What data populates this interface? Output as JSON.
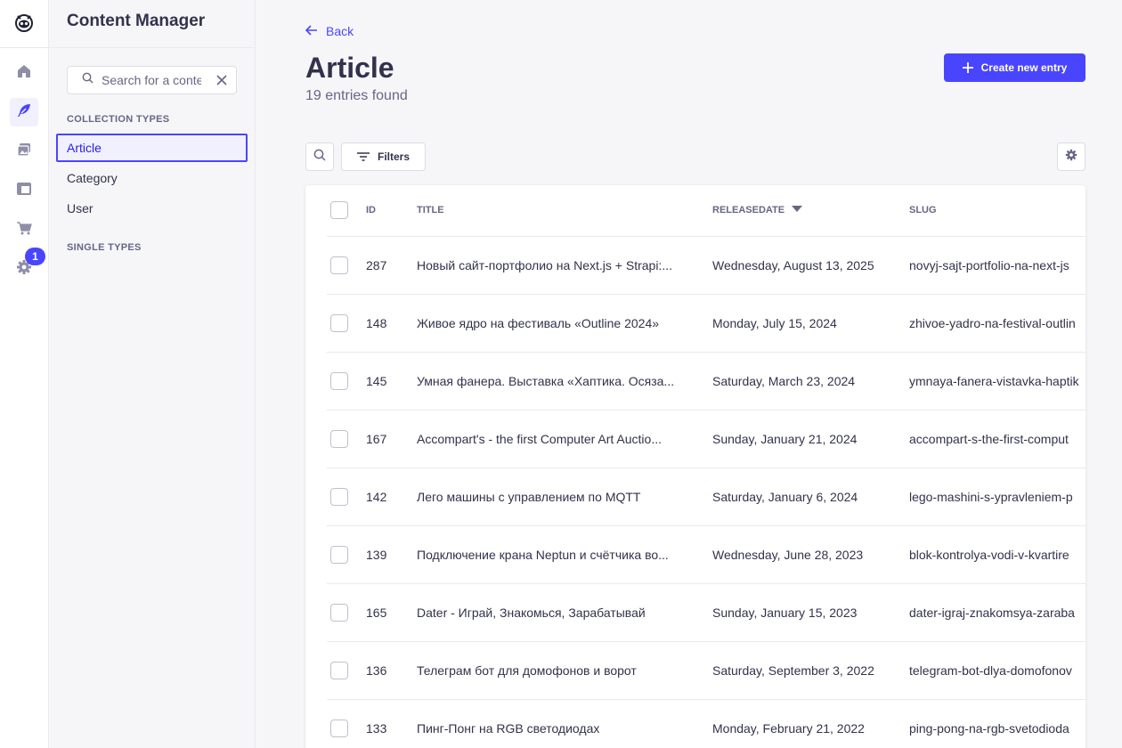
{
  "nav": {
    "badge_count": "1"
  },
  "sidebar": {
    "title": "Content Manager",
    "search_placeholder": "Search for a content type",
    "collection_types_label": "COLLECTION TYPES",
    "single_types_label": "SINGLE TYPES",
    "items": [
      {
        "label": "Article",
        "active": true
      },
      {
        "label": "Category",
        "active": false
      },
      {
        "label": "User",
        "active": false
      }
    ]
  },
  "header": {
    "back_label": "Back",
    "title": "Article",
    "subtitle": "19 entries found",
    "create_label": "Create new entry"
  },
  "toolbar": {
    "filters_label": "Filters"
  },
  "table": {
    "columns": {
      "id": "ID",
      "title": "TITLE",
      "releasedate": "RELEASEDATE",
      "slug": "SLUG"
    },
    "rows": [
      {
        "id": "287",
        "title": "Новый сайт-портфолио на Next.js + Strapi:...",
        "date": "Wednesday, August 13, 2025",
        "slug": "novyj-sajt-portfolio-na-next-js"
      },
      {
        "id": "148",
        "title": "Живое ядро на фестиваль «Outline 2024»",
        "date": "Monday, July 15, 2024",
        "slug": "zhivoe-yadro-na-festival-outlin"
      },
      {
        "id": "145",
        "title": "Умная фанера. Выставка «Хаптика. Осяза...",
        "date": "Saturday, March 23, 2024",
        "slug": "ymnaya-fanera-vistavka-haptik"
      },
      {
        "id": "167",
        "title": "Accompart's - the first Computer Art Auctio...",
        "date": "Sunday, January 21, 2024",
        "slug": "accompart-s-the-first-comput"
      },
      {
        "id": "142",
        "title": "Лего машины с управлением по MQTT",
        "date": "Saturday, January 6, 2024",
        "slug": "lego-mashini-s-ypravleniem-p"
      },
      {
        "id": "139",
        "title": "Подключение крана Neptun и счётчика во...",
        "date": "Wednesday, June 28, 2023",
        "slug": "blok-kontrolya-vodi-v-kvartire"
      },
      {
        "id": "165",
        "title": "Dater - Играй, Знакомься, Зарабатывай",
        "date": "Sunday, January 15, 2023",
        "slug": "dater-igraj-znakomsya-zaraba"
      },
      {
        "id": "136",
        "title": "Телеграм бот для домофонов и ворот",
        "date": "Saturday, September 3, 2022",
        "slug": "telegram-bot-dlya-domofonov"
      },
      {
        "id": "133",
        "title": "Пинг-Понг на RGB светодиодах",
        "date": "Monday, February 21, 2022",
        "slug": "ping-pong-na-rgb-svetodioda"
      }
    ]
  },
  "colors": {
    "primary": "#4945ff",
    "text": "#32324d",
    "muted": "#666687",
    "background": "#f6f6f9"
  }
}
